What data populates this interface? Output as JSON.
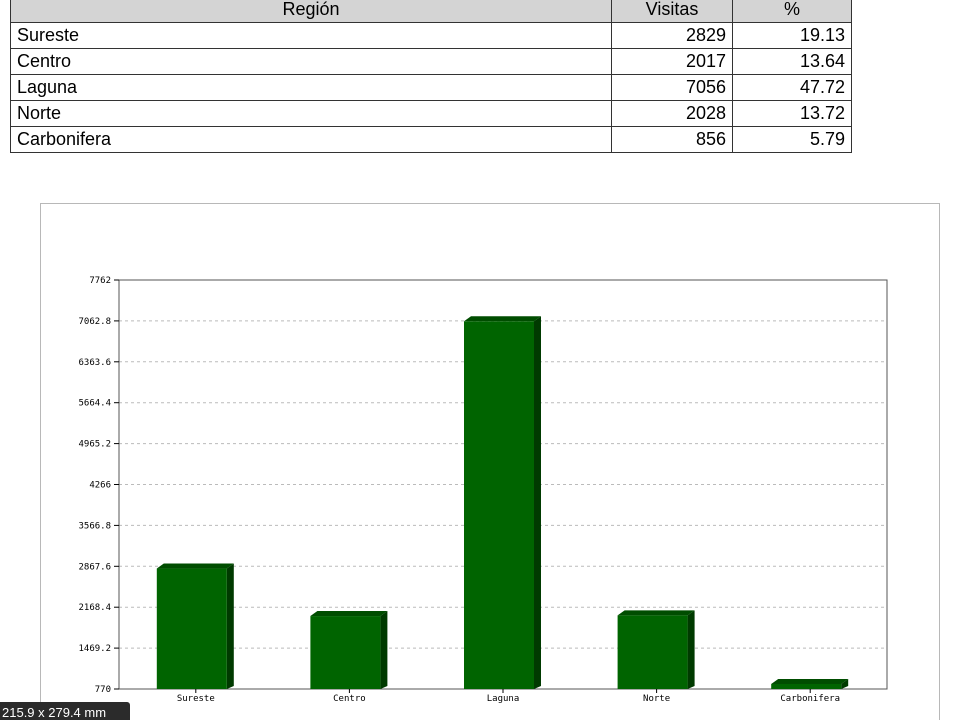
{
  "table": {
    "headers": {
      "region": "Región",
      "visits": "Visitas",
      "percent": "%"
    },
    "rows": [
      {
        "region": "Sureste",
        "visits": "2829",
        "percent": "19.13"
      },
      {
        "region": "Centro",
        "visits": "2017",
        "percent": "13.64"
      },
      {
        "region": "Laguna",
        "visits": "7056",
        "percent": "47.72"
      },
      {
        "region": "Norte",
        "visits": "2028",
        "percent": "13.72"
      },
      {
        "region": "Carbonifera",
        "visits": "856",
        "percent": "5.79"
      }
    ]
  },
  "chart_data": {
    "type": "bar",
    "title": "",
    "xlabel": "",
    "ylabel": "",
    "categories": [
      "Sureste",
      "Centro",
      "Laguna",
      "Norte",
      "Carbonifera"
    ],
    "values": [
      2829,
      2017,
      7056,
      2028,
      856
    ],
    "ylim": [
      770,
      7762
    ],
    "yticks": [
      "770",
      "1469.2",
      "2168.4",
      "2867.6",
      "3566.8",
      "4266",
      "4965.2",
      "5664.4",
      "6363.6",
      "7062.8",
      "7762"
    ],
    "grid": true,
    "bar_color": "#006400",
    "bar_side_color": "#003a00",
    "bar_top_color": "#004d00"
  },
  "page_size_indicator": "215.9 x 279.4 mm"
}
